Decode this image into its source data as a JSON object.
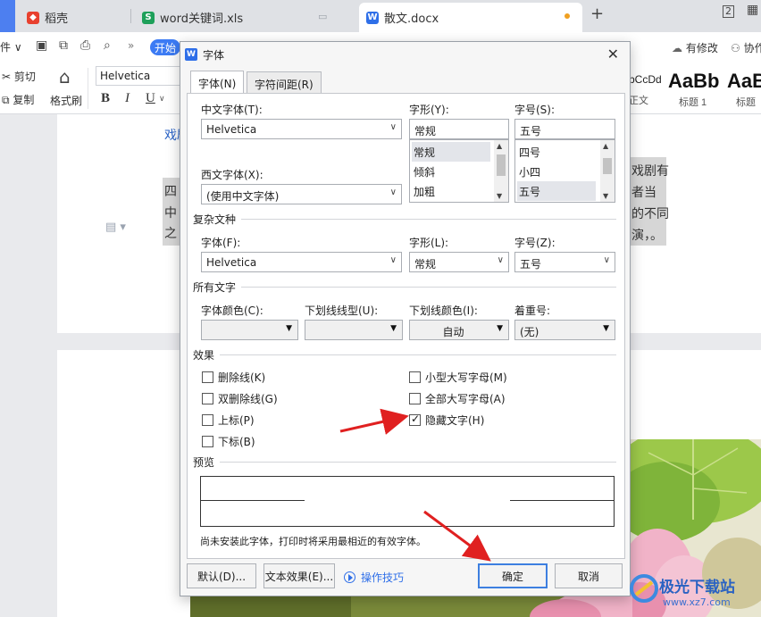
{
  "tabs": [
    {
      "label": "稻壳",
      "icon": "daoke-icon",
      "color": "#e8402e"
    },
    {
      "label": "word关键词.xls",
      "icon": "spreadsheet-icon",
      "color": "#1ea05a"
    },
    {
      "label": "散文.docx",
      "icon": "word-doc-icon",
      "color": "#2f6fe8"
    }
  ],
  "ribbon": {
    "start_tab": "开始",
    "has_changes": "有修改",
    "collab": "协作",
    "cut": "剪切",
    "copy": "复制",
    "format_painter": "格式刷",
    "font_name": "Helvetica",
    "style_body": "正文",
    "style_body_sample": "bCcDd",
    "style_h1": "标题 1",
    "style_h1_sample": "AaBb",
    "style_h2": "标题",
    "style_h2_sample": "AaB"
  },
  "document": {
    "line_top": "戏剧",
    "frag_left_1": "四",
    "frag_left_2": "中",
    "frag_left_3": "之",
    "frag_right_1": "戏剧有",
    "frag_right_2": "者当",
    "frag_right_3": "的不同",
    "frag_right_4": "演，。"
  },
  "dialog": {
    "title": "字体",
    "tabs": [
      "字体(N)",
      "字符间距(R)"
    ],
    "cn_font_label": "中文字体(T):",
    "cn_font_value": "Helvetica",
    "style_label": "字形(Y):",
    "style_value": "常规",
    "style_options": [
      "常规",
      "倾斜",
      "加粗"
    ],
    "size_label": "字号(S):",
    "size_value": "五号",
    "size_options": [
      "四号",
      "小四",
      "五号"
    ],
    "west_font_label": "西文字体(X):",
    "west_font_value": "(使用中文字体)",
    "complex_section": "复杂文种",
    "complex_font_label": "字体(F):",
    "complex_font_value": "Helvetica",
    "complex_style_label": "字形(L):",
    "complex_style_value": "常规",
    "complex_size_label": "字号(Z):",
    "complex_size_value": "五号",
    "all_text_section": "所有文字",
    "font_color_label": "字体颜色(C):",
    "underline_type_label": "下划线线型(U):",
    "underline_color_label": "下划线颜色(I):",
    "underline_color_value": "自动",
    "emphasis_label": "着重号:",
    "emphasis_value": "(无)",
    "effects_section": "效果",
    "effects": [
      {
        "label": "删除线(K)",
        "checked": false
      },
      {
        "label": "双删除线(G)",
        "checked": false
      },
      {
        "label": "上标(P)",
        "checked": false
      },
      {
        "label": "下标(B)",
        "checked": false
      },
      {
        "label": "小型大写字母(M)",
        "checked": false
      },
      {
        "label": "全部大写字母(A)",
        "checked": false
      },
      {
        "label": "隐藏文字(H)",
        "checked": true
      }
    ],
    "preview_section": "预览",
    "preview_note": "尚未安装此字体，打印时将采用最相近的有效字体。",
    "default_btn": "默认(D)...",
    "text_effect_btn": "文本效果(E)...",
    "tips_link": "操作技巧",
    "ok_btn": "确定",
    "cancel_btn": "取消"
  },
  "watermark": {
    "text": "极光下载站",
    "url": "www.xz7.com"
  },
  "colors": {
    "accent": "#2f6fe8",
    "arrow": "#e02020",
    "tab_bar": "#dfe1e5"
  }
}
